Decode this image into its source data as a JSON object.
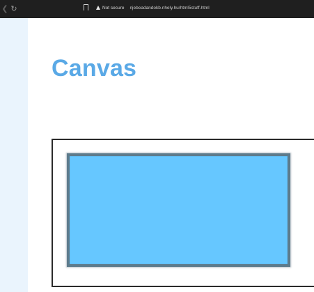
{
  "browser": {
    "back_icon": "chevron-left-icon",
    "reload_icon": "reload-icon",
    "bookmark_icon": "bookmark-icon",
    "security_icon": "warning-triangle-icon",
    "security_label": "Not secure",
    "url": "njebeadandokb.nhely.hu/html5stuff.html"
  },
  "page": {
    "title": "Canvas"
  },
  "colors": {
    "title": "#5aa9e6",
    "sidebar": "#eaf4fd",
    "canvas_fill": "#66c7ff",
    "canvas_stroke": "#5d7b8c",
    "topbar": "#1f1f1f"
  }
}
